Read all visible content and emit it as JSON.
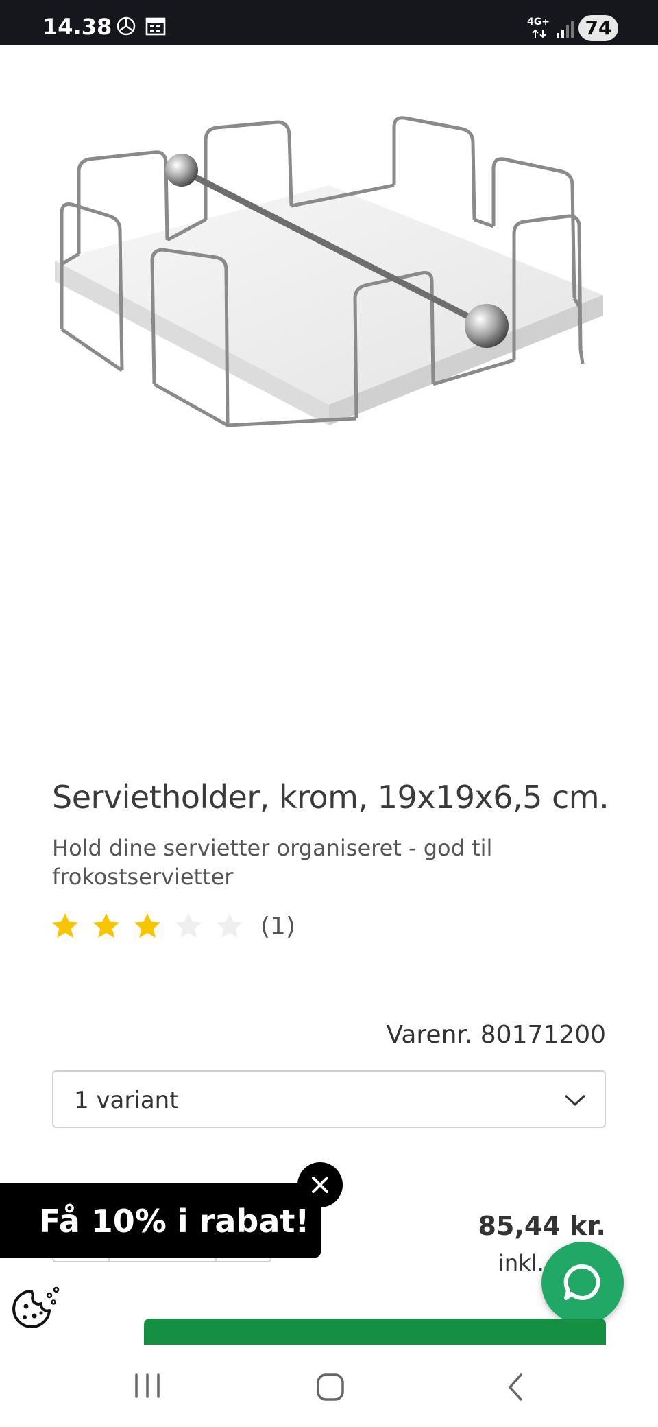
{
  "status_bar": {
    "time": "14.38",
    "network": "4G+",
    "battery": "74"
  },
  "product": {
    "title": "Servietholder, krom, 19x19x6,5 cm.",
    "description": "Hold dine servietter organiseret - god til frokostservietter",
    "rating_value": 3,
    "rating_max": 5,
    "rating_count": "(1)",
    "sku": "Varenr. 80171200",
    "variant": "1 variant",
    "price": "85,44 kr.",
    "price_note": "inkl. m"
  },
  "promo": {
    "text": "Få 10% i rabat!"
  },
  "colors": {
    "star_filled": "#f7c600",
    "star_empty": "#efefef",
    "chat": "#21a866",
    "cart": "#159043"
  },
  "icons": {
    "close": "close-icon",
    "chevron": "chevron-down-icon",
    "cookie": "cookie-icon",
    "chat": "chat-icon"
  }
}
